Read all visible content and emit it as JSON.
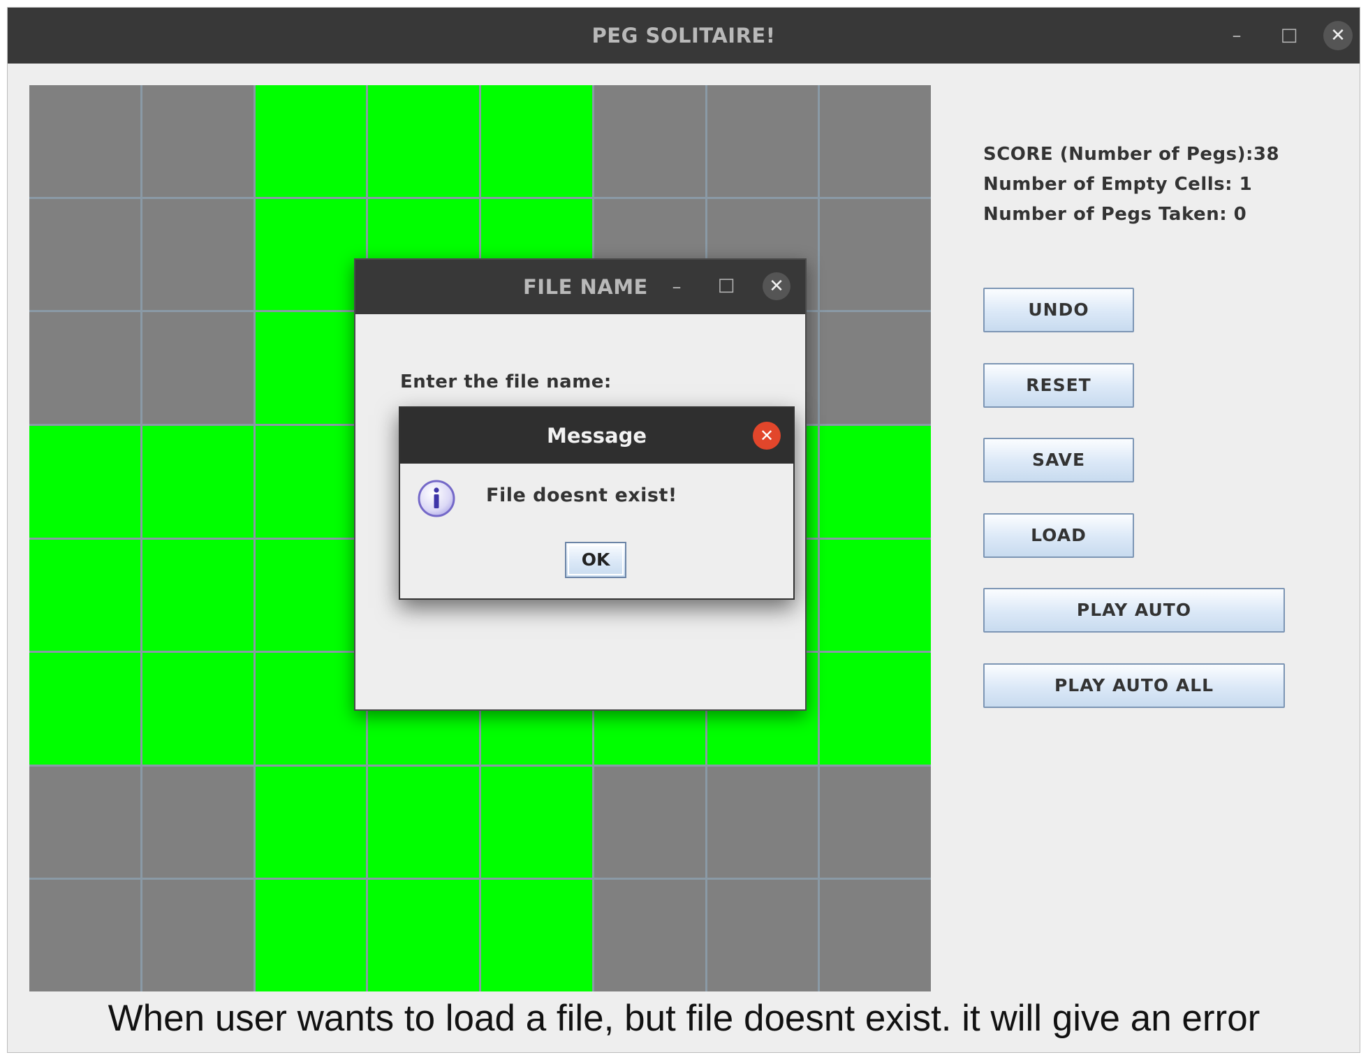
{
  "window": {
    "title": "PEG SOLITAIRE!",
    "minimize_glyph": "–",
    "maximize_glyph": "□",
    "close_glyph": "✕"
  },
  "board": {
    "rows": 8,
    "cols": 8,
    "peg_color": "#00ff00",
    "empty_color": "#808080",
    "cells": [
      [
        0,
        0,
        1,
        1,
        1,
        0,
        0,
        0
      ],
      [
        0,
        0,
        1,
        1,
        1,
        0,
        0,
        0
      ],
      [
        0,
        0,
        1,
        1,
        1,
        0,
        0,
        0
      ],
      [
        1,
        1,
        1,
        1,
        1,
        1,
        1,
        1
      ],
      [
        1,
        1,
        1,
        1,
        1,
        1,
        1,
        1
      ],
      [
        1,
        1,
        1,
        1,
        1,
        1,
        1,
        1
      ],
      [
        0,
        0,
        1,
        1,
        1,
        0,
        0,
        0
      ],
      [
        0,
        0,
        1,
        1,
        1,
        0,
        0,
        0
      ]
    ]
  },
  "stats": {
    "score": "SCORE (Number of Pegs):38",
    "empty_cells": "Number of Empty Cells: 1",
    "pegs_taken": "Number of Pegs Taken: 0"
  },
  "buttons": {
    "undo": "UNDO",
    "reset": "RESET",
    "save": "SAVE",
    "load": "LOAD",
    "play_auto": "PLAY AUTO",
    "play_auto_all": "PLAY AUTO ALL"
  },
  "file_dialog": {
    "title": "FILE NAME",
    "prompt": "Enter the file name:",
    "minimize_glyph": "–",
    "maximize_glyph": "□",
    "close_glyph": "✕"
  },
  "message_dialog": {
    "title": "Message",
    "text": "File doesnt exist!",
    "ok_label": "OK",
    "close_glyph": "✕",
    "icon": "info-icon"
  },
  "caption": "When user wants to load a file, but file doesnt exist. it will give an error"
}
